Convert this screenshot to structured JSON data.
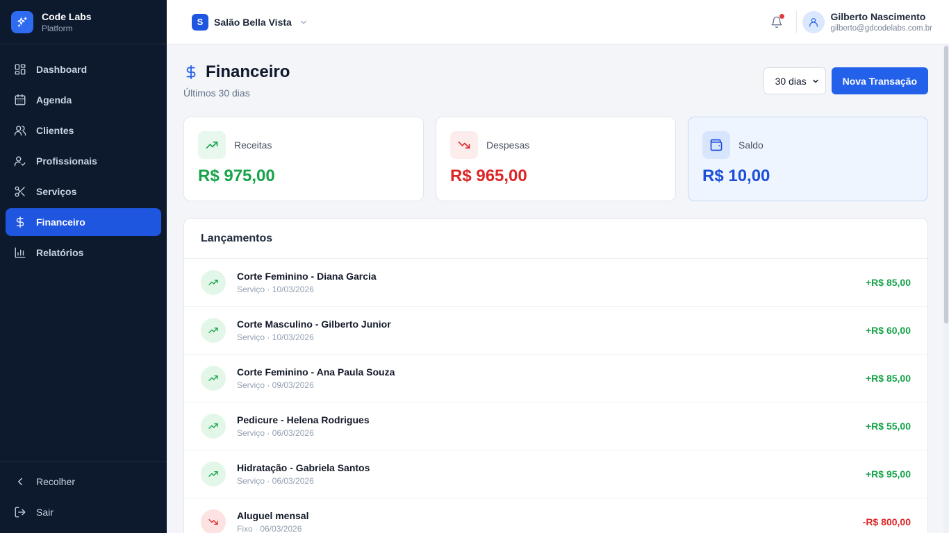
{
  "brand": {
    "name": "Code Labs",
    "subtitle": "Platform",
    "logo_icon": "sparkles-icon"
  },
  "sidebar": {
    "items": [
      {
        "label": "Dashboard",
        "icon": "grid-icon"
      },
      {
        "label": "Agenda",
        "icon": "calendar-icon"
      },
      {
        "label": "Clientes",
        "icon": "users-icon"
      },
      {
        "label": "Profissionais",
        "icon": "user-check-icon"
      },
      {
        "label": "Serviços",
        "icon": "scissors-icon"
      },
      {
        "label": "Financeiro",
        "icon": "dollar-icon",
        "active": true
      },
      {
        "label": "Relatórios",
        "icon": "bar-chart-icon"
      }
    ],
    "collapse_label": "Recolher",
    "logout_label": "Sair"
  },
  "header": {
    "salon_initial": "S",
    "salon_name": "Salão Bella Vista",
    "user_name": "Gilberto Nascimento",
    "user_email": "gilberto@gdcodelabs.com.br",
    "notification_dot": true
  },
  "page": {
    "title": "Financeiro",
    "subtitle": "Últimos 30 dias",
    "period_value": "30 dias",
    "new_button": "Nova Transação"
  },
  "summary": {
    "receitas": {
      "label": "Receitas",
      "value": "R$ 975,00",
      "color": "#16a34a"
    },
    "despesas": {
      "label": "Despesas",
      "value": "R$ 965,00",
      "color": "#dc2626"
    },
    "saldo": {
      "label": "Saldo",
      "value": "R$ 10,00",
      "color": "#1d4ed8"
    }
  },
  "ledger": {
    "title": "Lançamentos",
    "rows": [
      {
        "title": "Corte Feminino - Diana Garcia",
        "meta": "Serviço · 10/03/2026",
        "amount": "+R$ 85,00",
        "type": "income"
      },
      {
        "title": "Corte Masculino - Gilberto Junior",
        "meta": "Serviço · 10/03/2026",
        "amount": "+R$ 60,00",
        "type": "income"
      },
      {
        "title": "Corte Feminino - Ana Paula Souza",
        "meta": "Serviço · 09/03/2026",
        "amount": "+R$ 85,00",
        "type": "income"
      },
      {
        "title": "Pedicure - Helena Rodrigues",
        "meta": "Serviço · 06/03/2026",
        "amount": "+R$ 55,00",
        "type": "income"
      },
      {
        "title": "Hidratação - Gabriela Santos",
        "meta": "Serviço · 06/03/2026",
        "amount": "+R$ 95,00",
        "type": "income"
      },
      {
        "title": "Aluguel mensal",
        "meta": "Fixo · 06/03/2026",
        "amount": "-R$ 800,00",
        "type": "expense"
      }
    ]
  },
  "colors": {
    "income": "#16a34a",
    "expense": "#dc2626",
    "accent": "#2361eb",
    "sidebar_bg": "#0d1a2e"
  }
}
